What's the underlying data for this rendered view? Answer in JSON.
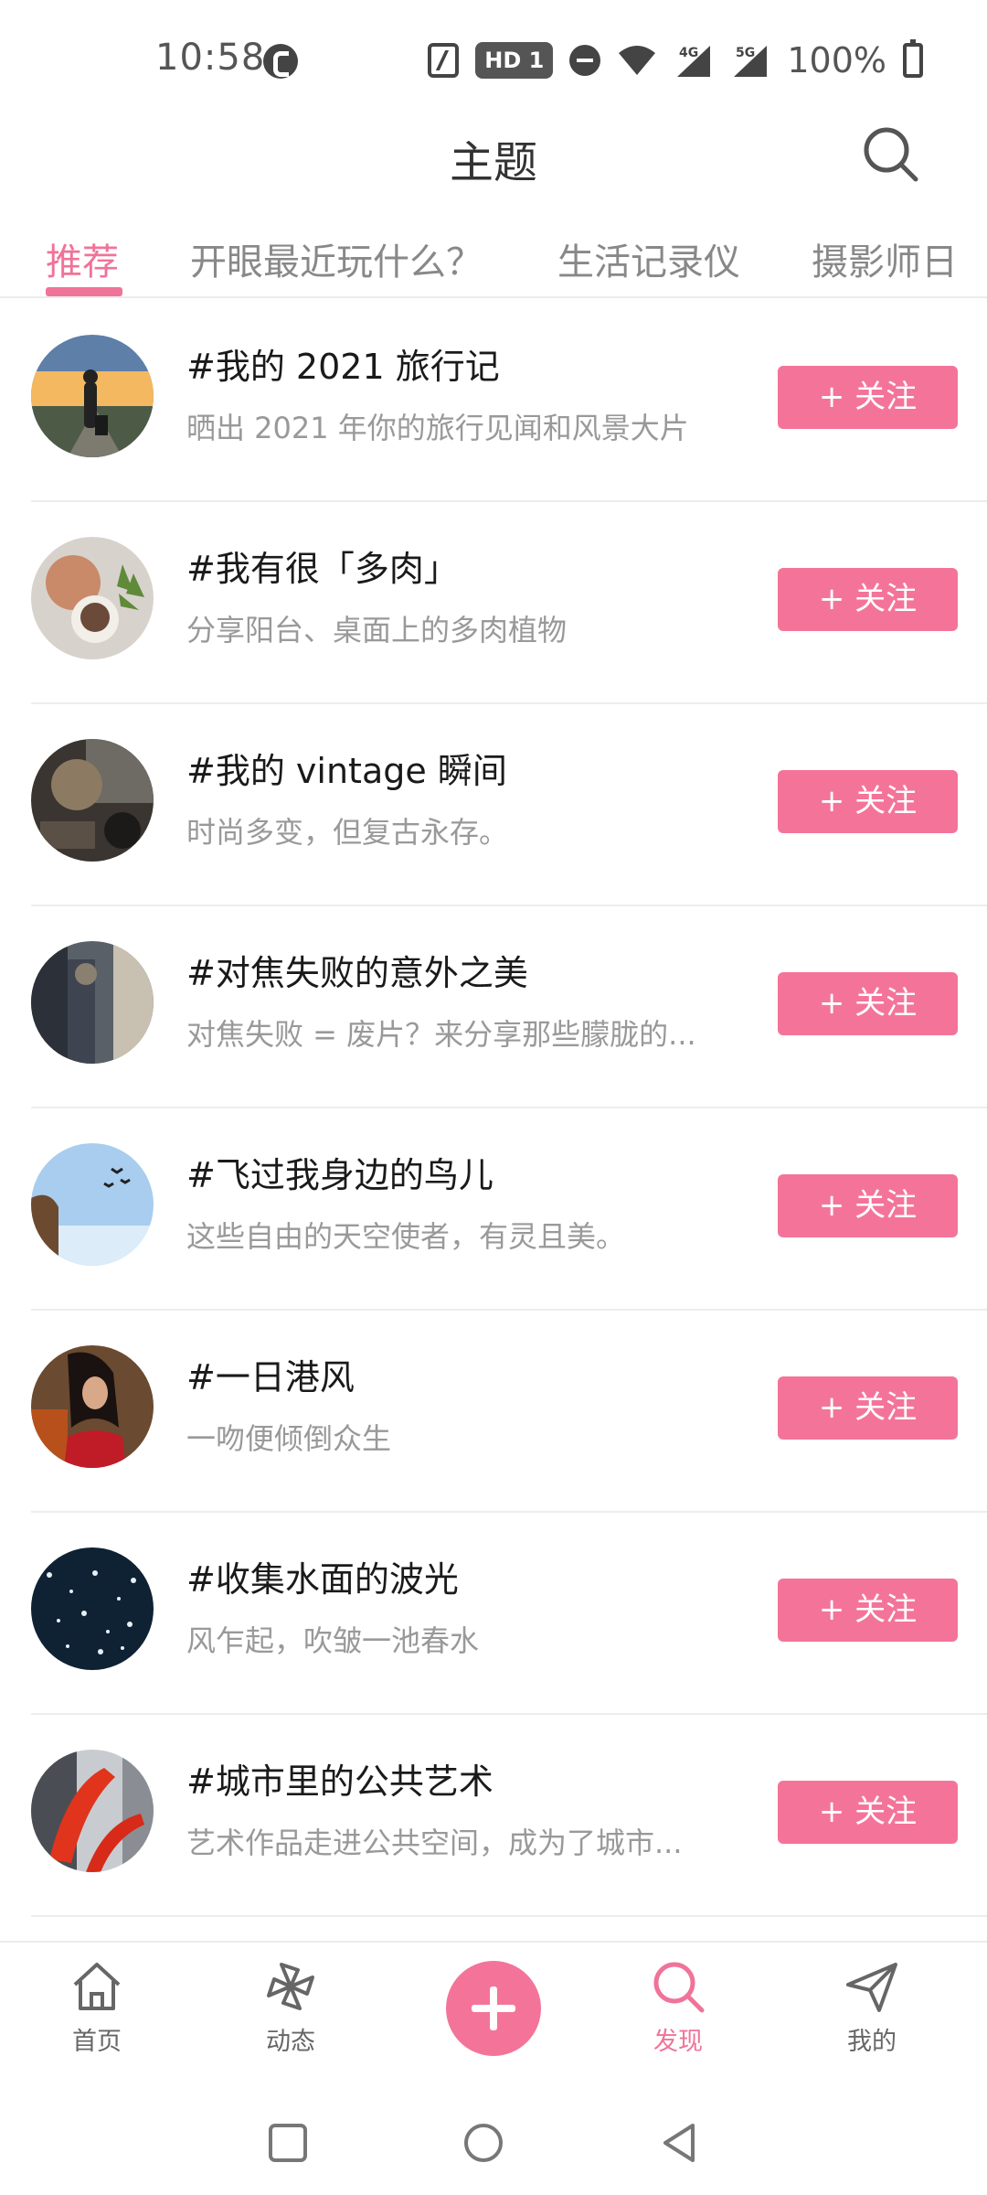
{
  "status_bar": {
    "time": "10:58",
    "hd_label": "HD 1",
    "network_4g": "4G",
    "network_5g": "5G",
    "battery": "100%"
  },
  "header": {
    "title": "主题"
  },
  "tabs": [
    {
      "label": "推荐",
      "active": true
    },
    {
      "label": "开眼最近玩什么？",
      "active": false
    },
    {
      "label": "生活记录仪",
      "active": false
    },
    {
      "label": "摄影师日",
      "active": false
    }
  ],
  "topics": [
    {
      "title": "#我的 2021 旅行记",
      "desc": "晒出 2021 年你的旅行见闻和风景大片",
      "follow": "+ 关注"
    },
    {
      "title": "#我有很「多肉」",
      "desc": "分享阳台、桌面上的多肉植物",
      "follow": "+ 关注"
    },
    {
      "title": "#我的 vintage 瞬间",
      "desc": "时尚多变，但复古永存。",
      "follow": "+ 关注"
    },
    {
      "title": "#对焦失败的意外之美",
      "desc": "对焦失败 = 废片？来分享那些朦胧的...",
      "follow": "+ 关注"
    },
    {
      "title": "#飞过我身边的鸟儿",
      "desc": "这些自由的天空使者，有灵且美。",
      "follow": "+ 关注"
    },
    {
      "title": "#一日港风",
      "desc": "一吻便倾倒众生",
      "follow": "+ 关注"
    },
    {
      "title": "#收集水面的波光",
      "desc": "风乍起，吹皱一池春水",
      "follow": "+ 关注"
    },
    {
      "title": "#城市里的公共艺术",
      "desc": "艺术作品走进公共空间，成为了城市...",
      "follow": "+ 关注"
    }
  ],
  "bottom_nav": {
    "home": "首页",
    "feed": "动态",
    "discover": "发现",
    "mine": "我的"
  },
  "colors": {
    "accent": "#f47499",
    "text": "#1a1a1a",
    "muted": "#999999"
  }
}
